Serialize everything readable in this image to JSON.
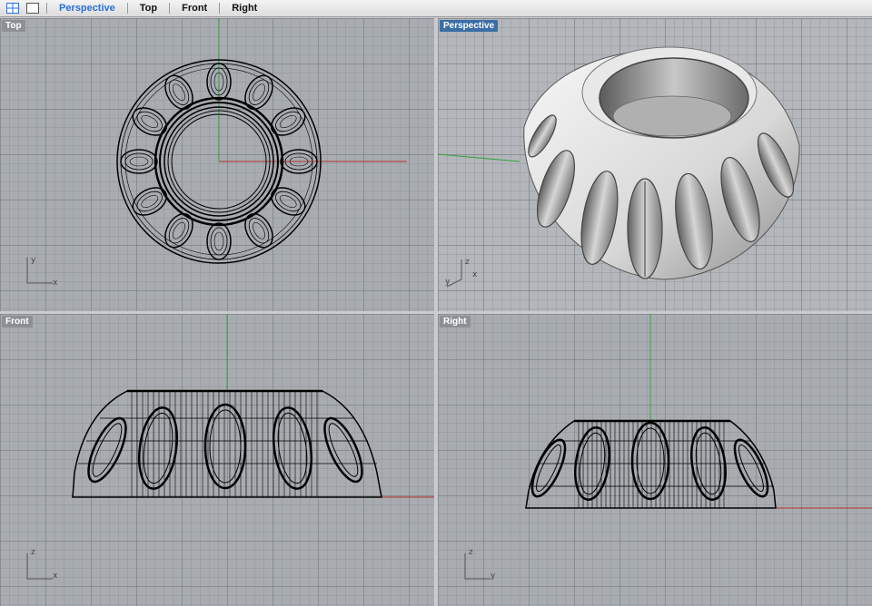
{
  "toolbar": {
    "icons": [
      "four-viewports-icon",
      "single-viewport-icon"
    ],
    "tabs": [
      {
        "label": "Perspective",
        "active": true
      },
      {
        "label": "Top",
        "active": false
      },
      {
        "label": "Front",
        "active": false
      },
      {
        "label": "Right",
        "active": false
      }
    ]
  },
  "viewports": {
    "top": {
      "label": "Top",
      "axes": [
        "y",
        "x"
      ]
    },
    "perspective": {
      "label": "Perspective",
      "active": true,
      "axes": [
        "z",
        "y",
        "x"
      ]
    },
    "front": {
      "label": "Front",
      "axes": [
        "z",
        "x"
      ]
    },
    "right": {
      "label": "Right",
      "axes": [
        "z",
        "y"
      ]
    }
  },
  "colors": {
    "active_tab": "#2a6fd6",
    "active_viewport_label": "#3a6ea5",
    "x_axis": "#b3312c",
    "y_axis": "#3aa046",
    "viewport_bg": "#a8acb1"
  }
}
